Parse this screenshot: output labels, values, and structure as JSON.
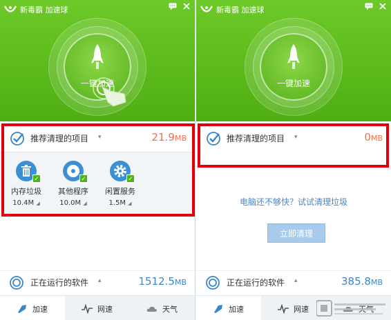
{
  "panels": [
    {
      "app_title": "新毒霸 加速球",
      "boost_label": "一键加速",
      "recommend": {
        "label": "推荐清理的项目",
        "size": "21.9",
        "unit": "MB"
      },
      "items": [
        {
          "icon": "trash-icon",
          "name": "内存垃圾",
          "size": "10.4M"
        },
        {
          "icon": "disc-icon",
          "name": "其他程序",
          "size": "10.0M"
        },
        {
          "icon": "gear-icon",
          "name": "闲置服务",
          "size": "1.5M"
        }
      ],
      "running": {
        "label": "正在运行的软件",
        "size": "1512.5",
        "unit": "MB"
      },
      "tabs": [
        {
          "icon": "rocket-icon",
          "label": "加速"
        },
        {
          "icon": "pulse-icon",
          "label": "网速"
        },
        {
          "icon": "cloud-icon",
          "label": "天气"
        }
      ]
    },
    {
      "app_title": "新毒霸 加速球",
      "boost_label": "一键加速",
      "recommend": {
        "label": "推荐清理的项目",
        "size": "0",
        "unit": "MB"
      },
      "tip": "电脑还不够快？试试清理垃圾",
      "clean_button": "立即清理",
      "running": {
        "label": "正在运行的软件",
        "size": "385.8",
        "unit": "MB"
      },
      "tabs": [
        {
          "icon": "rocket-icon",
          "label": "加速"
        },
        {
          "icon": "pulse-icon",
          "label": "网速"
        },
        {
          "icon": "cloud-icon",
          "label": "天气"
        }
      ]
    }
  ],
  "colors": {
    "header_green": "#5cbb1c",
    "highlight_red": "#e0000a",
    "size_orange": "#f07050",
    "size_blue": "#3b85c9"
  }
}
